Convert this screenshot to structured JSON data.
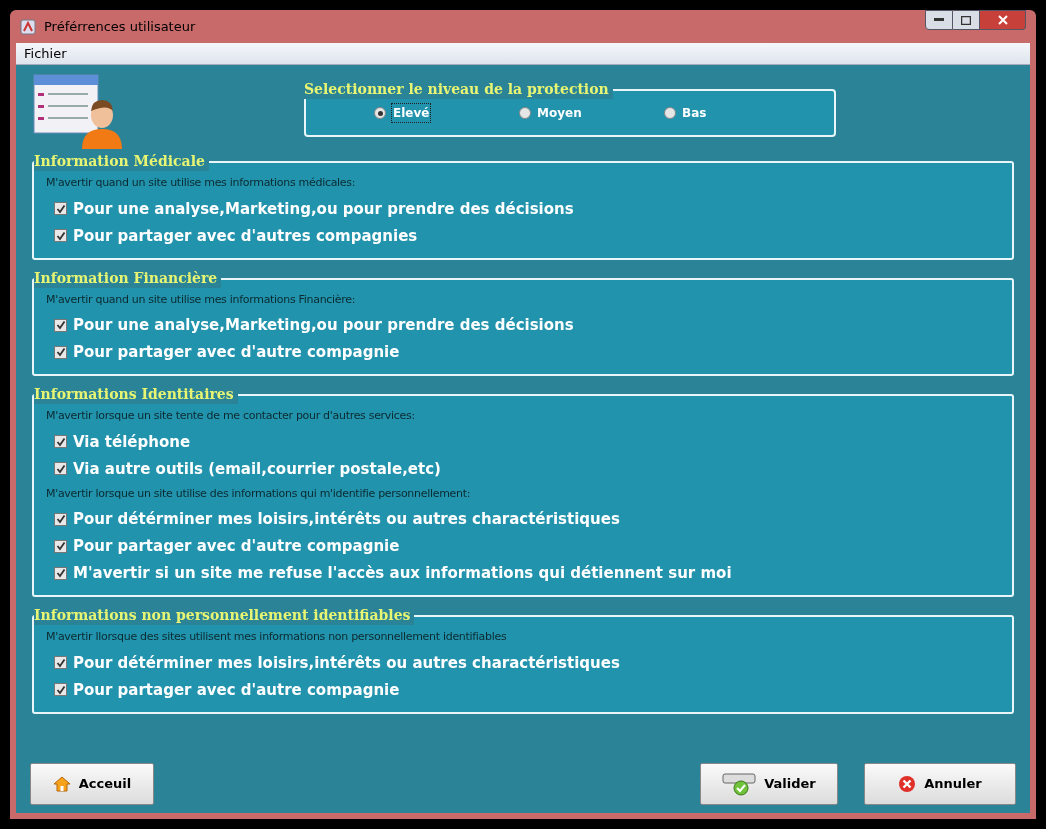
{
  "window": {
    "title": "Préférrences utilisateur"
  },
  "menu": [
    "Fichier"
  ],
  "protection": {
    "title": "Selectionner le niveau de la protection",
    "options": [
      {
        "label": "Elevé",
        "selected": true
      },
      {
        "label": "Moyen",
        "selected": false
      },
      {
        "label": "Bas",
        "selected": false
      }
    ]
  },
  "sections": [
    {
      "title": "Information Médicale",
      "items": [
        {
          "kind": "note",
          "text": "M'avertir quand un site utilise mes informations médicales:"
        },
        {
          "kind": "checkbox",
          "text": "Pour une analyse,Marketing,ou pour prendre des décisions",
          "checked": true
        },
        {
          "kind": "checkbox",
          "text": "Pour partager avec d'autres compagnies",
          "checked": true
        }
      ]
    },
    {
      "title": "Information Financière",
      "items": [
        {
          "kind": "note",
          "text": "M'avertir quand un site utilise mes informations Financière:"
        },
        {
          "kind": "checkbox",
          "text": "Pour une analyse,Marketing,ou pour prendre des décisions",
          "checked": true
        },
        {
          "kind": "checkbox",
          "text": "Pour partager avec d'autre compagnie",
          "checked": true
        }
      ]
    },
    {
      "title": "Informations Identitaires",
      "items": [
        {
          "kind": "note",
          "text": "M'avertir lorsque un site tente de me contacter pour d'autres services:"
        },
        {
          "kind": "checkbox",
          "text": "Via téléphone",
          "checked": true
        },
        {
          "kind": "checkbox",
          "text": "Via autre outils (email,courrier postale,etc)",
          "checked": true
        },
        {
          "kind": "note",
          "text": "M'avertir lorsque un site utilise des informations qui m'identifie personnellement:"
        },
        {
          "kind": "checkbox",
          "text": "Pour détérminer mes loisirs,intérêts ou autres charactéristiques",
          "checked": true
        },
        {
          "kind": "checkbox",
          "text": "Pour partager avec d'autre compagnie",
          "checked": true
        },
        {
          "kind": "checkbox",
          "text": "M'avertir si un site me refuse l'accès aux informations qui détiennent sur moi",
          "checked": true
        }
      ]
    },
    {
      "title": "Informations non personnellement identifiables",
      "items": [
        {
          "kind": "note",
          "text": "M'avertir llorsque des sites utilisent mes informations non personnellement identifiables"
        },
        {
          "kind": "checkbox",
          "text": "Pour détérminer mes loisirs,intérêts ou autres charactéristiques",
          "checked": true
        },
        {
          "kind": "checkbox",
          "text": "Pour partager avec d'autre compagnie",
          "checked": true
        }
      ]
    }
  ],
  "buttons": [
    {
      "kind": "home",
      "label": "Acceuil"
    },
    {
      "kind": "validate",
      "label": "Valider"
    },
    {
      "kind": "cancel",
      "label": "Annuler"
    }
  ]
}
